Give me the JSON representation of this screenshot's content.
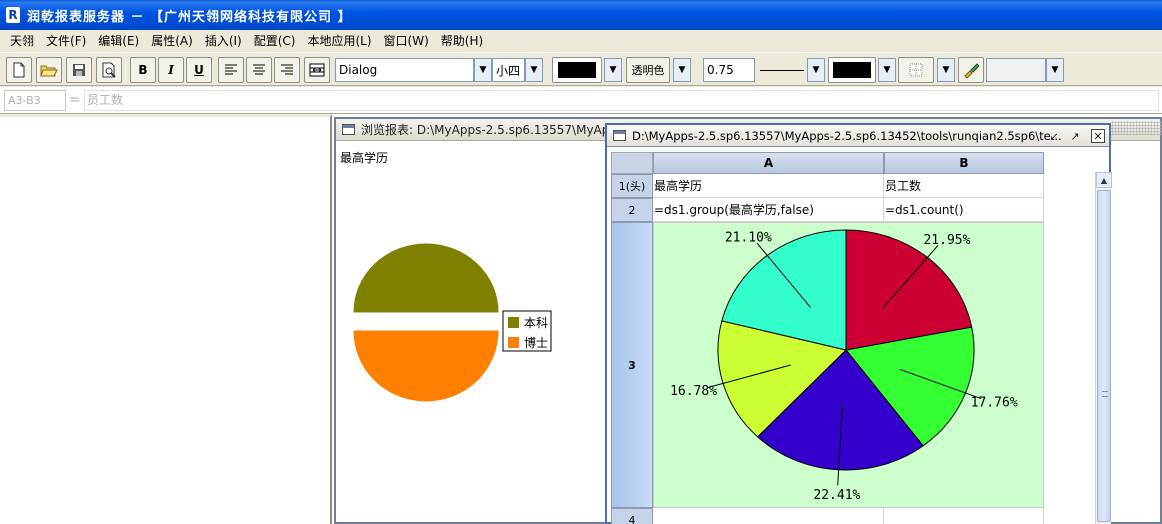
{
  "app": {
    "title": "润乾报表服务器 － 【广州天翎网络科技有限公司 】",
    "icon_letter": "R"
  },
  "menu": [
    "天翎",
    "文件(F)",
    "编辑(E)",
    "属性(A)",
    "插入(I)",
    "配置(C)",
    "本地应用(L)",
    "窗口(W)",
    "帮助(H)"
  ],
  "toolbar": {
    "bold": "B",
    "italic": "I",
    "underline": "U",
    "font_family": "Dialog",
    "font_size": "小四",
    "transparent_label": "透明色",
    "line_width": "0.75",
    "colors": {
      "font": "#000000",
      "border": "#000000"
    }
  },
  "formula": {
    "cell_ref": "A3-B3",
    "value": "员工数"
  },
  "preview": {
    "title": "浏览报表: D:\\MyApps-2.5.sp6.13557\\MyApps-",
    "label": "最高学历",
    "legend": [
      {
        "label": "本科",
        "color": "#808000"
      },
      {
        "label": "博士",
        "color": "#ff8000"
      }
    ]
  },
  "designer": {
    "title": "D:\\MyApps-2.5.sp6.13557\\MyApps-2.5.sp6.13452\\tools\\runqian2.5sp6\\te...",
    "columns": [
      "A",
      "B"
    ],
    "rows": [
      {
        "head": "1(头)",
        "a": "最高学历",
        "b": "员工数"
      },
      {
        "head": "2",
        "a": "=ds1.group(最高学历,false)",
        "b": "=ds1.count()"
      },
      {
        "head": "3"
      },
      {
        "head": "4"
      }
    ]
  },
  "chart_data": {
    "type": "pie",
    "title": "",
    "slices": [
      {
        "label": "21.95%",
        "value": 21.95,
        "color": "#cc0033"
      },
      {
        "label": "17.76%",
        "value": 17.76,
        "color": "#33ff33"
      },
      {
        "label": "22.41%",
        "value": 22.41,
        "color": "#3300cc"
      },
      {
        "label": "16.78%",
        "value": 16.78,
        "color": "#ccff33"
      },
      {
        "label": "21.10%",
        "value": 21.1,
        "color": "#33ffcc"
      }
    ]
  }
}
